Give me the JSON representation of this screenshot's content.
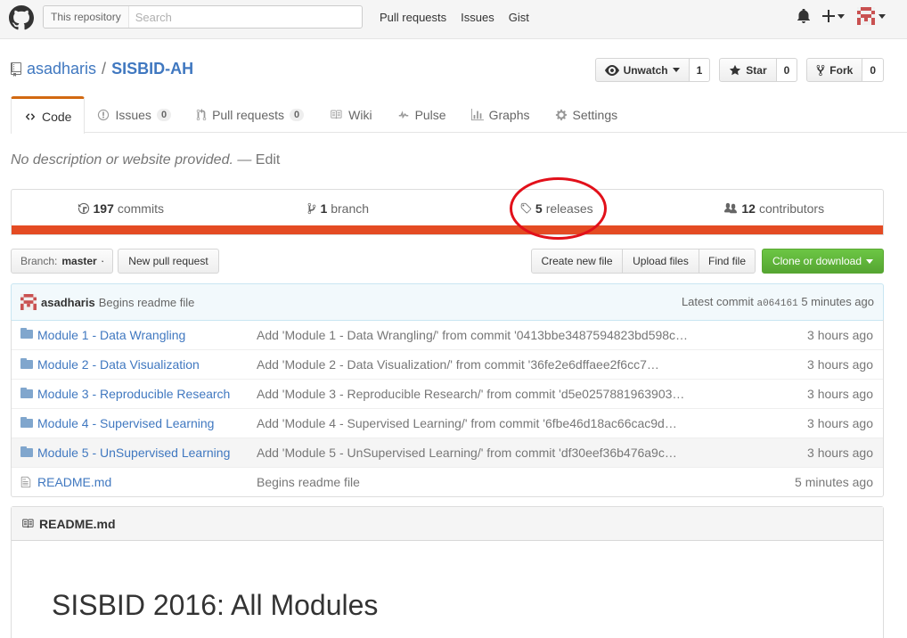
{
  "header": {
    "search_scope": "This repository",
    "search_placeholder": "Search",
    "nav": [
      "Pull requests",
      "Issues",
      "Gist"
    ]
  },
  "repo": {
    "owner": "asadharis",
    "name": "SISBID-AH",
    "unwatch_label": "Unwatch",
    "watch_count": "1",
    "star_label": "Star",
    "star_count": "0",
    "fork_label": "Fork",
    "fork_count": "0"
  },
  "tabs": [
    {
      "label": "Code"
    },
    {
      "label": "Issues",
      "count": "0"
    },
    {
      "label": "Pull requests",
      "count": "0"
    },
    {
      "label": "Wiki"
    },
    {
      "label": "Pulse"
    },
    {
      "label": "Graphs"
    },
    {
      "label": "Settings"
    }
  ],
  "description": {
    "text": "No description or website provided.",
    "separator": " — ",
    "edit": "Edit"
  },
  "summary": {
    "commits_num": "197",
    "commits_label": "commits",
    "branch_num": "1",
    "branch_label": "branch",
    "releases_num": "5",
    "releases_label": "releases",
    "contributors_num": "12",
    "contributors_label": "contributors",
    "language_color": "#e44b23"
  },
  "file_nav": {
    "branch_prefix": "Branch:",
    "branch_name": "master",
    "new_pr": "New pull request",
    "create_file": "Create new file",
    "upload_files": "Upload files",
    "find_file": "Find file",
    "clone": "Clone or download"
  },
  "commit": {
    "author": "asadharis",
    "message": "Begins readme file",
    "latest_label": "Latest commit",
    "sha": "a064161",
    "age": "5 minutes ago"
  },
  "files": [
    {
      "name": "Module 1 - Data Wrangling",
      "message": "Add 'Module 1 - Data Wrangling/' from commit '0413bbe3487594823bd598c…",
      "age": "3 hours ago"
    },
    {
      "name": "Module 2 - Data Visualization",
      "message": "Add 'Module 2 - Data Visualization/' from commit '36fe2e6dffaee2f6cc7…",
      "age": "3 hours ago"
    },
    {
      "name": "Module 3 - Reproducible Research",
      "message": "Add 'Module 3 - Reproducible Research/' from commit 'd5e0257881963903…",
      "age": "3 hours ago"
    },
    {
      "name": "Module 4 - Supervised Learning",
      "message": "Add 'Module 4 - Supervised Learning/' from commit '6fbe46d18ac66cac9d…",
      "age": "3 hours ago"
    },
    {
      "name": "Module 5 - UnSupervised Learning",
      "message": "Add 'Module 5 - UnSupervised Learning/' from commit 'df30eef36b476a9c…",
      "age": "3 hours ago"
    },
    {
      "name": "README.md",
      "message": "Begins readme file",
      "age": "5 minutes ago"
    }
  ],
  "readme": {
    "header": "README.md",
    "title": "SISBID 2016: All Modules"
  }
}
